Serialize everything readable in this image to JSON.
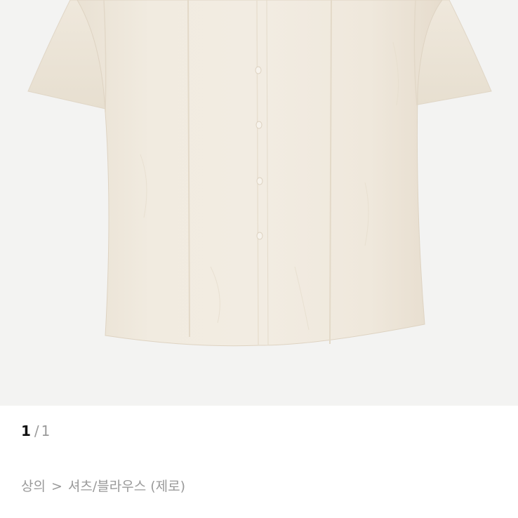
{
  "product_image": {
    "alt": "",
    "background_color": "#f3f3f2",
    "garment_color": "#efe8dc"
  },
  "pager": {
    "current": "1",
    "separator": "/",
    "total": "1"
  },
  "breadcrumb": {
    "category": "상의",
    "separator": ">",
    "subcategory": "셔츠/블라우스 (제로)"
  }
}
